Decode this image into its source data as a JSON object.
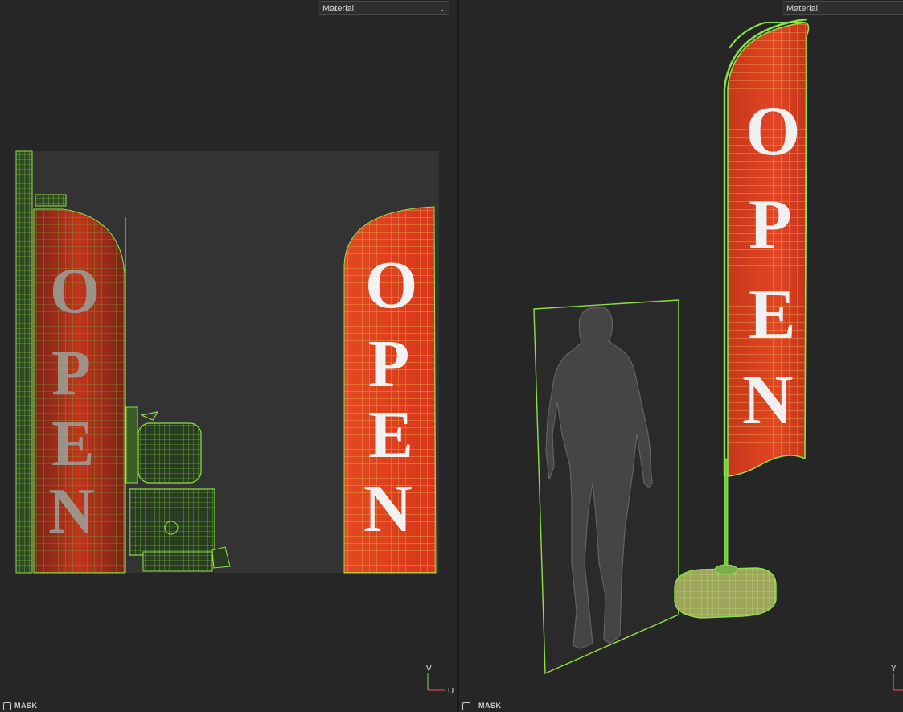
{
  "left_viewport": {
    "shading_mode": "Material",
    "axis_vertical": "V",
    "axis_horizontal": "U",
    "mask_label": "MASK"
  },
  "right_viewport": {
    "shading_mode": "Material",
    "axis_vertical": "Y",
    "mask_label": "MASK"
  },
  "flag_text": [
    "O",
    "P",
    "E",
    "N"
  ],
  "colors": {
    "flag_red": "#d63a1c",
    "wire_green": "#8ee04a",
    "wire_yellow": "#e8e860",
    "uv_tile": "#343434",
    "background": "#262626"
  },
  "icons": [
    "dropdown-chevron-icon",
    "mask-toggle-icon",
    "axis-gizmo-icon"
  ]
}
